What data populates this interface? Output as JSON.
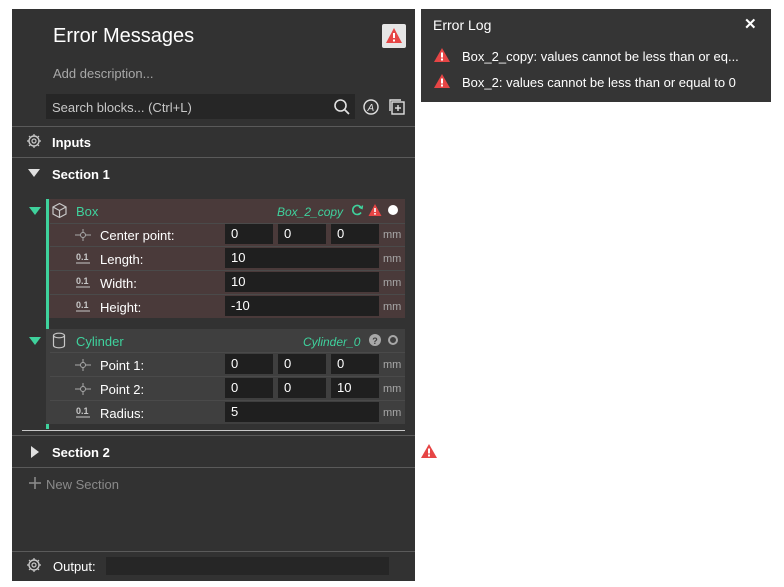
{
  "editor": {
    "title": "Error Messages",
    "description_placeholder": "Add description...",
    "search_placeholder": "Search blocks... (Ctrl+L)",
    "inputs_label": "Inputs",
    "section1_label": "Section 1",
    "section2_label": "Section 2",
    "new_section_label": "New Section",
    "output_label": "Output:",
    "output_value": ""
  },
  "box_block": {
    "name": "Box",
    "id": "Box_2_copy",
    "fields": [
      {
        "label": "Center point:",
        "values": [
          "0",
          "0",
          "0"
        ],
        "unit": "mm"
      },
      {
        "label": "Length:",
        "values": [
          "10"
        ],
        "unit": "mm"
      },
      {
        "label": "Width:",
        "values": [
          "10"
        ],
        "unit": "mm"
      },
      {
        "label": "Height:",
        "values": [
          "-10"
        ],
        "unit": "mm"
      }
    ]
  },
  "cylinder_block": {
    "name": "Cylinder",
    "id": "Cylinder_0",
    "fields": [
      {
        "label": "Point 1:",
        "values": [
          "0",
          "0",
          "0"
        ],
        "unit": "mm"
      },
      {
        "label": "Point 2:",
        "values": [
          "0",
          "0",
          "10"
        ],
        "unit": "mm"
      },
      {
        "label": "Radius:",
        "values": [
          "5"
        ],
        "unit": "mm"
      }
    ]
  },
  "error_log": {
    "title": "Error Log",
    "close_glyph": "✕",
    "messages": [
      "Box_2_copy: values cannot be less than or eq...",
      "Box_2: values cannot be less than or equal to 0"
    ]
  },
  "colors": {
    "panel_bg": "#323232",
    "accent": "#3fd29d",
    "warning": "#e64545",
    "box_block_bg": "#4a3a3a",
    "cyl_block_bg": "#3f3f3f"
  },
  "icons": {
    "warning": "warning-triangle-icon",
    "search": "search-icon",
    "gear": "gear-icon",
    "cube": "cube-icon",
    "cylinder": "cylinder-icon",
    "point": "point-icon",
    "dimension": "dimension-icon",
    "refresh": "refresh-icon",
    "help": "help-icon",
    "plus": "plus-icon"
  }
}
